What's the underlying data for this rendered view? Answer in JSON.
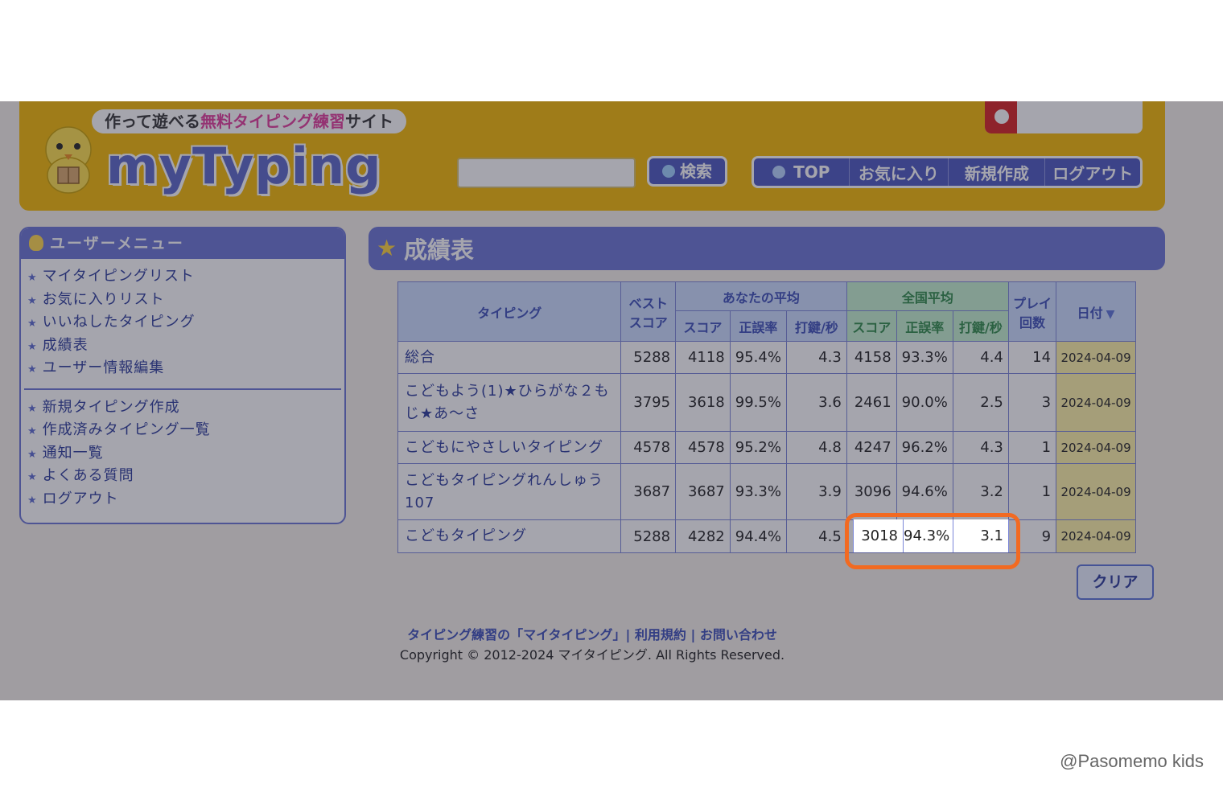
{
  "header": {
    "tagline_pre": "作って遊べる",
    "tagline_highlight": "無料タイピング練習",
    "tagline_post": "サイト",
    "logo": "myTyping",
    "search_button": "検索",
    "nav": [
      "TOP",
      "お気に入り",
      "新規作成",
      "ログアウト"
    ]
  },
  "sidebar": {
    "title": "ユーザーメニュー",
    "group1": [
      "マイタイピングリスト",
      "お気に入りリスト",
      "いいねしたタイピング",
      "成績表",
      "ユーザー情報編集"
    ],
    "group2": [
      "新規タイピング作成",
      "作成済みタイピング一覧",
      "通知一覧",
      "よくある質問",
      "ログアウト"
    ]
  },
  "main": {
    "title": "成績表",
    "headers": {
      "typing": "タイピング",
      "best1": "ベスト",
      "best2": "スコア",
      "your_avg": "あなたの平均",
      "national_avg": "全国平均",
      "play1": "プレイ",
      "play2": "回数",
      "date": "日付",
      "score": "スコア",
      "accuracy": "正誤率",
      "kps": "打鍵/秒"
    },
    "rows": [
      {
        "name": "総合",
        "best": "5288",
        "my_score": "4118",
        "my_acc": "95.4%",
        "my_kps": "4.3",
        "nat_score": "4158",
        "nat_acc": "93.3%",
        "nat_kps": "4.4",
        "plays": "14",
        "date": "2024-04-09"
      },
      {
        "name": "こどもよう(1)★ひらがな２もじ★あ〜さ",
        "best": "3795",
        "my_score": "3618",
        "my_acc": "99.5%",
        "my_kps": "3.6",
        "nat_score": "2461",
        "nat_acc": "90.0%",
        "nat_kps": "2.5",
        "plays": "3",
        "date": "2024-04-09"
      },
      {
        "name": "こどもにやさしいタイピング",
        "best": "4578",
        "my_score": "4578",
        "my_acc": "95.2%",
        "my_kps": "4.8",
        "nat_score": "4247",
        "nat_acc": "96.2%",
        "nat_kps": "4.3",
        "plays": "1",
        "date": "2024-04-09"
      },
      {
        "name": "こどもタイピングれんしゅう107",
        "best": "3687",
        "my_score": "3687",
        "my_acc": "93.3%",
        "my_kps": "3.9",
        "nat_score": "3096",
        "nat_acc": "94.6%",
        "nat_kps": "3.2",
        "plays": "1",
        "date": "2024-04-09"
      },
      {
        "name": "こどもタイピング",
        "best": "5288",
        "my_score": "4282",
        "my_acc": "94.4%",
        "my_kps": "4.5",
        "nat_score": "3018",
        "nat_acc": "94.3%",
        "nat_kps": "3.1",
        "plays": "9",
        "date": "2024-04-09"
      }
    ],
    "clear_button": "クリア"
  },
  "footer": {
    "links": "タイピング練習の「マイタイピング」| 利用規約 | お問い合わせ",
    "copyright": "Copyright © 2012-2024 マイタイピング. All Rights Reserved."
  },
  "watermark": "@Pasomemo kids",
  "colors": {
    "header": "#f5b800",
    "accent": "#6a74d4",
    "highlight": "#f26a21"
  }
}
